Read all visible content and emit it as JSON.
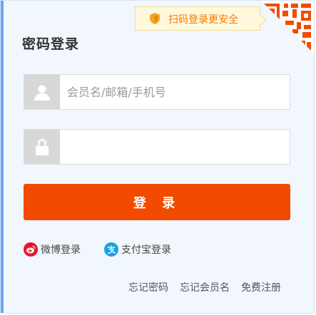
{
  "qr_tip": {
    "text": "扫码登录更安全",
    "icon": "shield-icon"
  },
  "title": "密码登录",
  "username": {
    "placeholder": "会员名/邮箱/手机号",
    "value": "",
    "icon": "user-icon"
  },
  "password": {
    "placeholder": "",
    "value": "",
    "icon": "lock-icon"
  },
  "login_button": "登 录",
  "social": {
    "weibo": {
      "label": "微博登录",
      "icon": "weibo-icon"
    },
    "alipay": {
      "label": "支付宝登录",
      "icon": "alipay-icon"
    }
  },
  "links": {
    "forgot_password": "忘记密码",
    "forgot_username": "忘记会员名",
    "register": "免费注册"
  },
  "colors": {
    "accent": "#f24b00",
    "tip_text": "#f57a00",
    "tip_bg": "#fff8dc",
    "weibo": "#e6162d",
    "alipay": "#1aa1e6"
  }
}
